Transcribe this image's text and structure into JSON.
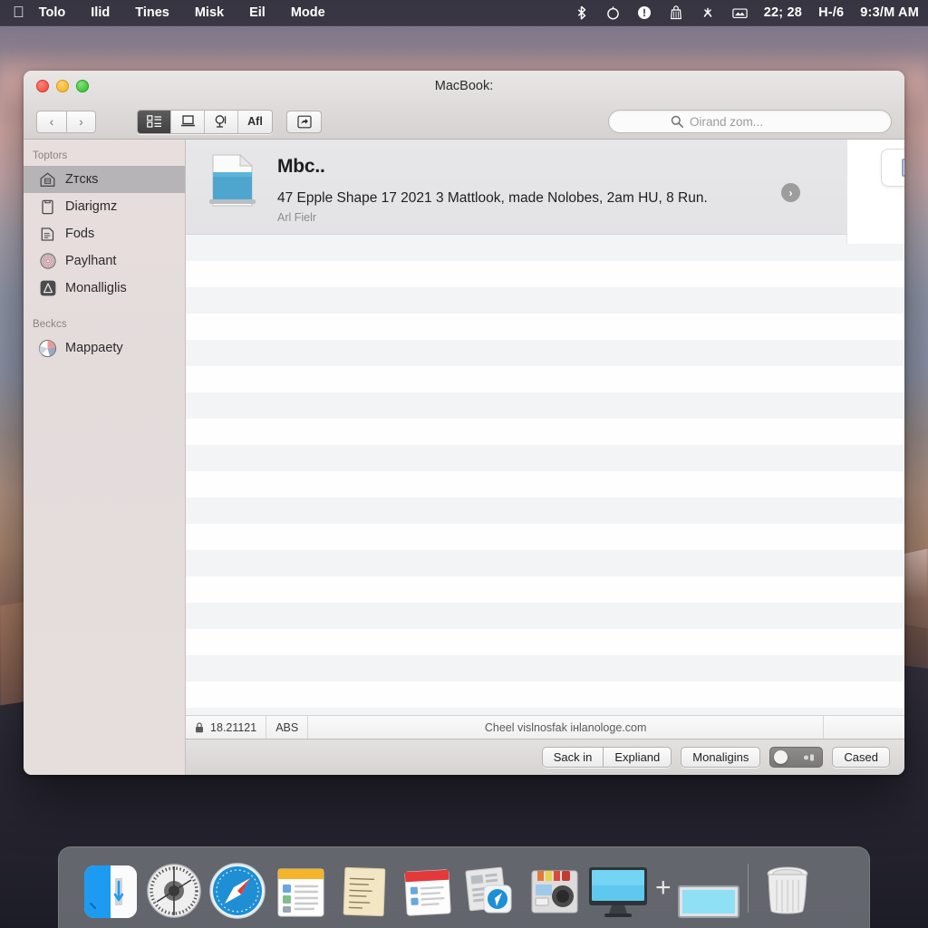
{
  "menubar": {
    "apple_icon": "apple-logo-icon",
    "items": [
      "Tolo",
      "Ilid",
      "Tines",
      "Misk",
      "Eil",
      "Mode"
    ],
    "status_icons": [
      "bluetooth-icon",
      "timer-icon",
      "battery-icon",
      "bag-icon",
      "airdrop-icon",
      "display-icon"
    ],
    "battery_text": "22; 28",
    "battery_suffix": "H-/6",
    "clock": "9:3/M AM"
  },
  "window": {
    "title": "MacBook:",
    "traffic_lights": [
      "close-button",
      "minimize-button",
      "zoom-button"
    ],
    "nav": {
      "back": "‹",
      "forward": "›"
    },
    "segmented": [
      {
        "name": "icon-view",
        "label": "",
        "active": true
      },
      {
        "name": "list-view",
        "label": "",
        "active": false
      },
      {
        "name": "column-view",
        "label": "",
        "active": false
      },
      {
        "name": "all-view",
        "label": "Afl",
        "active": false
      }
    ],
    "action_button": "share-icon",
    "search": {
      "icon": "search-icon",
      "placeholder": "Oirand zom...",
      "value": ""
    }
  },
  "sidebar": {
    "sections": [
      {
        "header": "Toptors",
        "items": [
          {
            "label": "Zтcкs",
            "icon": "home-icon",
            "selected": true
          },
          {
            "label": "Diarigmz",
            "icon": "document-icon",
            "selected": false
          },
          {
            "label": "Fods",
            "icon": "files-icon",
            "selected": false
          },
          {
            "label": "Paylhant",
            "icon": "fingerprint-icon",
            "selected": false
          },
          {
            "label": "Monalliglis",
            "icon": "applications-icon",
            "selected": false
          }
        ]
      },
      {
        "header": "Beckcs",
        "items": [
          {
            "label": "Mappaety",
            "icon": "pie-disk-icon",
            "selected": false
          }
        ]
      }
    ]
  },
  "main": {
    "file": {
      "icon": "document-blue-icon",
      "title": "Mbc..",
      "description": "47 Epple Shape 17 2021 3 Mattlook, made Nolobes, 2am HU, 8 Run.",
      "subtitle": "Arl Fielr",
      "disclosure": "›"
    },
    "check_panel": {
      "checkbox": "checked-checkbox",
      "checked": true,
      "mark": "✓"
    }
  },
  "statusbar": {
    "lock_icon": "lock-icon",
    "count": "18.21121",
    "unit": "ABS",
    "center_text": "Cheel vislnosfak інlanologe.com"
  },
  "bottombar": {
    "buttons_group": [
      "Sack in",
      "Expliand"
    ],
    "button_middle": "Monaligins",
    "toggle": {
      "name": "view-toggle",
      "on": false
    },
    "button_right": "Cased"
  },
  "dock": {
    "items": [
      "finder-icon",
      "clock-icon",
      "safari-icon",
      "notes-icon",
      "stickies-icon",
      "calendar-icon",
      "preview-icon",
      "photobooth-icon",
      "display-monitor-icon"
    ],
    "plus": "+",
    "extra": "screen-icon",
    "trash": "trash-icon"
  },
  "colors": {
    "accent_blue": "#4a9fd4",
    "selection_gray": "#b7b4b8",
    "sidebar_bg": "#e5dddc",
    "menubar_bg": "#2c2834"
  }
}
